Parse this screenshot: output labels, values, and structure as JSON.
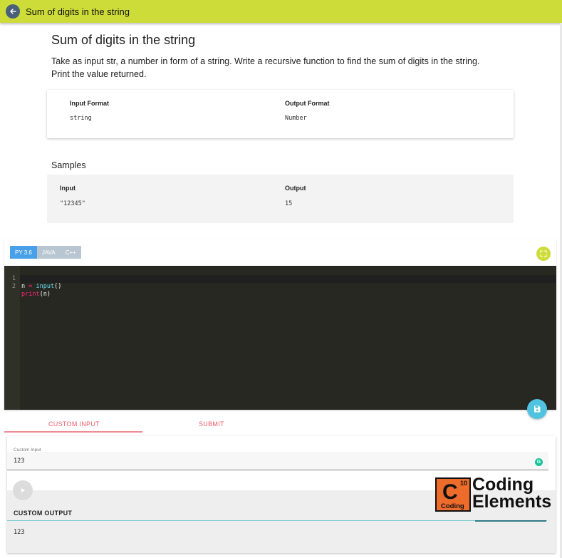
{
  "header": {
    "title": "Sum of digits in the string"
  },
  "problem": {
    "title": "Sum of digits in the string",
    "description": "Take as input str, a number in form of a string. Write a recursive function to find the sum of digits in the string. Print the value returned.",
    "input_format_label": "Input Format",
    "input_format_value": "string",
    "output_format_label": "Output Format",
    "output_format_value": "Number"
  },
  "samples": {
    "title": "Samples",
    "input_label": "Input",
    "input_value": "\"12345\"",
    "output_label": "Output",
    "output_value": "15"
  },
  "editor": {
    "languages": [
      "PY 3.6",
      "JAVA",
      "C++"
    ],
    "active_language": "PY 3.6",
    "line_numbers": [
      "1",
      "2"
    ],
    "code": {
      "line1_var": "n",
      "line1_op": "=",
      "line1_fn": "input",
      "line1_paren": "()",
      "line2_fn": "print",
      "line2_args": "(n)"
    }
  },
  "actions": {
    "custom_input_tab": "CUSTOM INPUT",
    "submit_tab": "SUBMIT"
  },
  "custom_input": {
    "label": "Custom Input",
    "value": "123",
    "grammarly_icon": "G"
  },
  "custom_output": {
    "label": "CUSTOM OUTPUT",
    "value": "123"
  },
  "watermark": {
    "logo_letter": "C",
    "logo_number": "10",
    "logo_small": "Coding",
    "line1": "Coding",
    "line2": "Elements"
  },
  "colors": {
    "header_bg": "#cddc39",
    "editor_bg": "#272822",
    "active_tab": "#4aa0e8",
    "accent_red": "#e95b6b",
    "save_fab": "#4fc3e0",
    "watermark_orange": "#ed6b2b"
  }
}
